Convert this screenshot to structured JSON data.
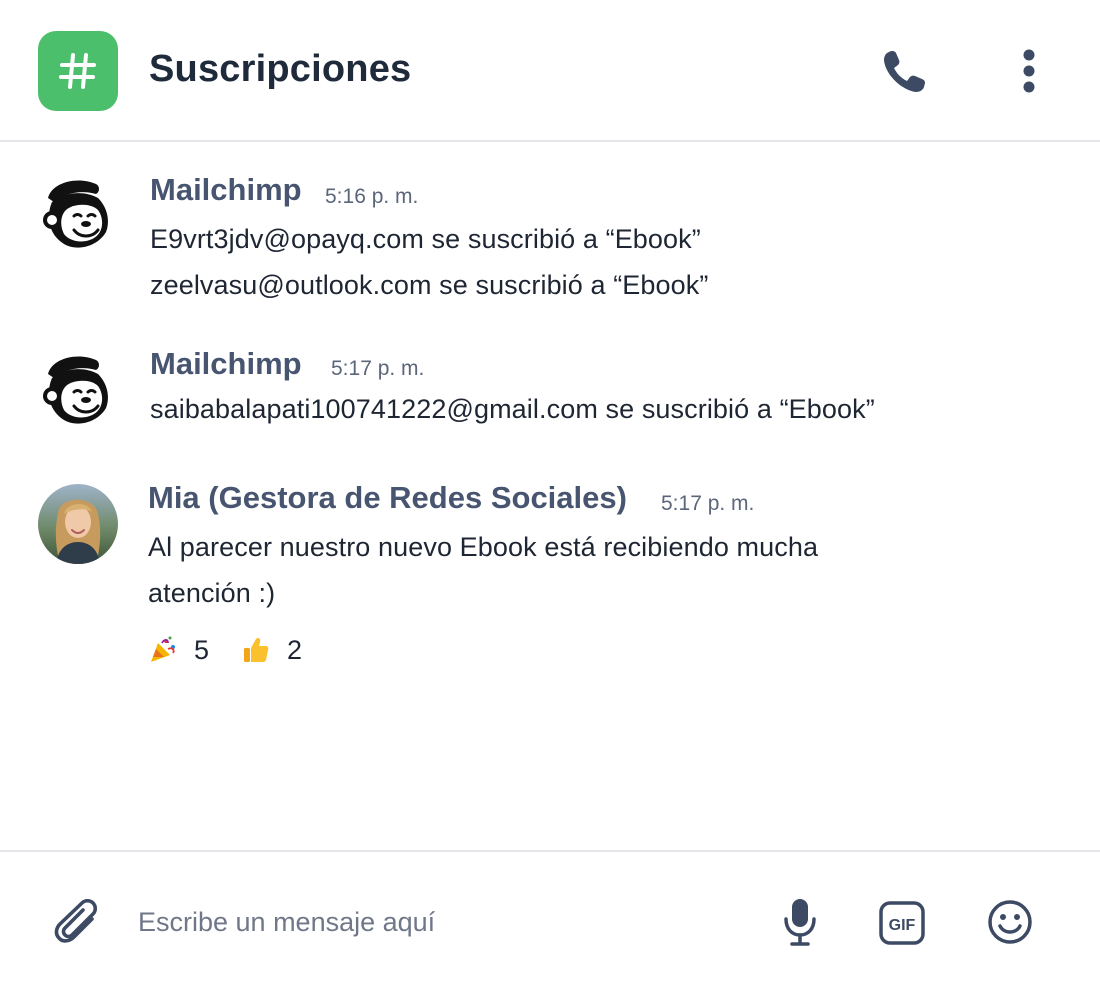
{
  "header": {
    "channel_icon": "hash-icon",
    "channel_name": "Suscripciones",
    "actions": [
      {
        "icon": "phone-icon"
      },
      {
        "icon": "kebab-menu-icon"
      }
    ]
  },
  "messages": [
    {
      "author": "Mailchimp",
      "avatar_icon": "mailchimp-logo",
      "time": "5:16 p. m.",
      "lines": [
        "E9vrt3jdv@opayq.com se suscribió a “Ebook”",
        "zeelvasu@outlook.com se suscribió a “Ebook”"
      ]
    },
    {
      "author": "Mailchimp",
      "avatar_icon": "mailchimp-logo",
      "time": "5:17 p. m.",
      "lines": [
        "saibabalapati100741222@gmail.com se suscribió a “Ebook”"
      ]
    },
    {
      "author": "Mia (Gestora de Redes Sociales)",
      "avatar_icon": "user-photo",
      "time": "5:17 p. m.",
      "lines": [
        "Al parecer nuestro nuevo Ebook está recibiendo mucha",
        "atención :)"
      ],
      "reactions": [
        {
          "emoji": "party-popper",
          "count": "5"
        },
        {
          "emoji": "thumbs-up",
          "count": "2"
        }
      ]
    }
  ],
  "composer": {
    "placeholder": "Escribe un mensaje aquí",
    "value": "",
    "icons": [
      "paperclip-icon",
      "microphone-icon",
      "gif-icon",
      "smiley-icon"
    ]
  },
  "colors": {
    "channel_badge": "#4bbf6b",
    "author_text": "#485570",
    "icon": "#3d4a63",
    "divider": "#e4e6ea"
  }
}
